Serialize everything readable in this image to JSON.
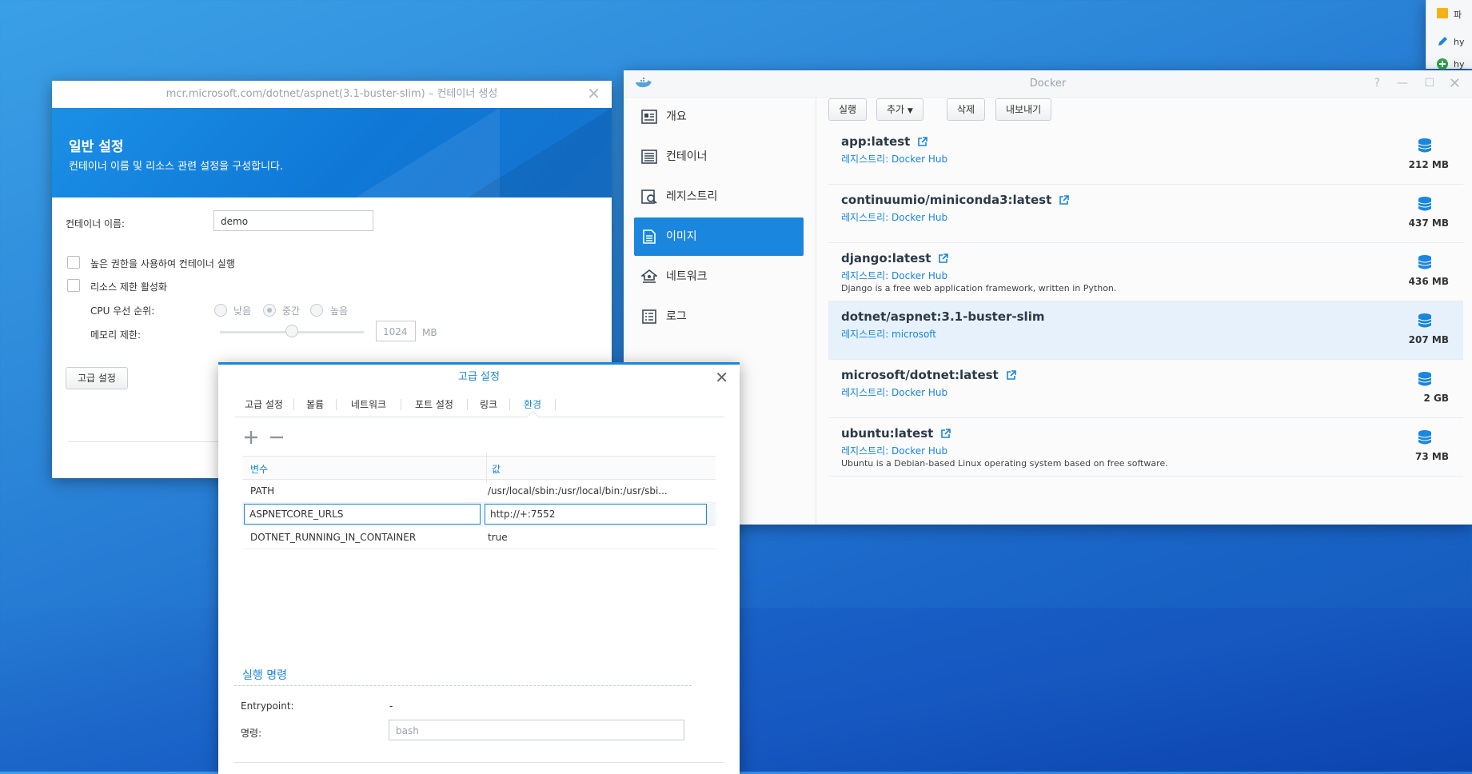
{
  "docker": {
    "title": "Docker",
    "sidebar": [
      {
        "label": "개요",
        "icon": "overview-icon"
      },
      {
        "label": "컨테이너",
        "icon": "container-icon"
      },
      {
        "label": "레지스트리",
        "icon": "registry-icon"
      },
      {
        "label": "이미지",
        "icon": "image-icon",
        "active": true
      },
      {
        "label": "네트워크",
        "icon": "network-icon"
      },
      {
        "label": "로그",
        "icon": "log-icon"
      }
    ],
    "toolbar": {
      "run_label": "실행",
      "add_label": "추가",
      "delete_label": "삭제",
      "export_label": "내보내기"
    },
    "images": [
      {
        "name": "app:latest",
        "registry": "레지스트리: Docker Hub",
        "description": "",
        "size": "212 MB"
      },
      {
        "name": "continuumio/miniconda3:latest",
        "registry": "레지스트리: Docker Hub",
        "description": "",
        "size": "437 MB"
      },
      {
        "name": "django:latest",
        "registry": "레지스트리: Docker Hub",
        "description": "Django is a free web application framework, written in Python.",
        "size": "436 MB"
      },
      {
        "name": "dotnet/aspnet:3.1-buster-slim",
        "registry": "레지스트리: microsoft",
        "description": "",
        "size": "207 MB",
        "selected": true
      },
      {
        "name": "microsoft/dotnet:latest",
        "registry": "레지스트리: Docker Hub",
        "description": "",
        "size": "2 GB"
      },
      {
        "name": "ubuntu:latest",
        "registry": "레지스트리: Docker Hub",
        "description": "Ubuntu is a Debian-based Linux operating system based on free software.",
        "size": "73 MB"
      }
    ]
  },
  "wizard": {
    "title": "mcr.microsoft.com/dotnet/aspnet(3.1-buster-slim) – 컨테이너 생성",
    "heading": "일반 설정",
    "subheading": "컨테이너 이름 및 리소스 관련 설정을 구성합니다.",
    "container_name_label": "컨테이너 이름:",
    "container_name_value": "demo",
    "privileged_label": "높은 권한을 사용하여 컨테이너 실행",
    "resource_limit_label": "리소스 제한 활성화",
    "cpu_priority_label": "CPU 우선 순위:",
    "cpu_options": [
      "낮음",
      "중간",
      "높음"
    ],
    "cpu_selected": "중간",
    "memory_label": "메모리 제한:",
    "memory_value": "1024",
    "memory_unit": "MB",
    "memory_slider_fraction": 0.5,
    "advanced_button_label": "고급 설정"
  },
  "advanced": {
    "title": "고급 설정",
    "tabs": [
      "고급 설정",
      "볼륨",
      "네트워크",
      "포트 설정",
      "링크",
      "환경"
    ],
    "active_tab": "환경",
    "env_headers": {
      "variable": "변수",
      "value": "값"
    },
    "env_rows": [
      {
        "variable": "PATH",
        "value": "/usr/local/sbin:/usr/local/bin:/usr/sbi..."
      },
      {
        "variable": "ASPNETCORE_URLS",
        "value": "http://+:7552",
        "editing": true
      },
      {
        "variable": "DOTNET_RUNNING_IN_CONTAINER",
        "value": "true"
      }
    ],
    "exec_section_title": "실행 명령",
    "entrypoint_label": "Entrypoint:",
    "entrypoint_value": "-",
    "command_label": "명령:",
    "command_value": "bash"
  },
  "side_window": {
    "items": [
      "파",
      "hy",
      "hy"
    ]
  },
  "colors": {
    "accent": "#1a86de",
    "desktop": "#2c86d8",
    "selected_row": "#e6f1fb"
  }
}
